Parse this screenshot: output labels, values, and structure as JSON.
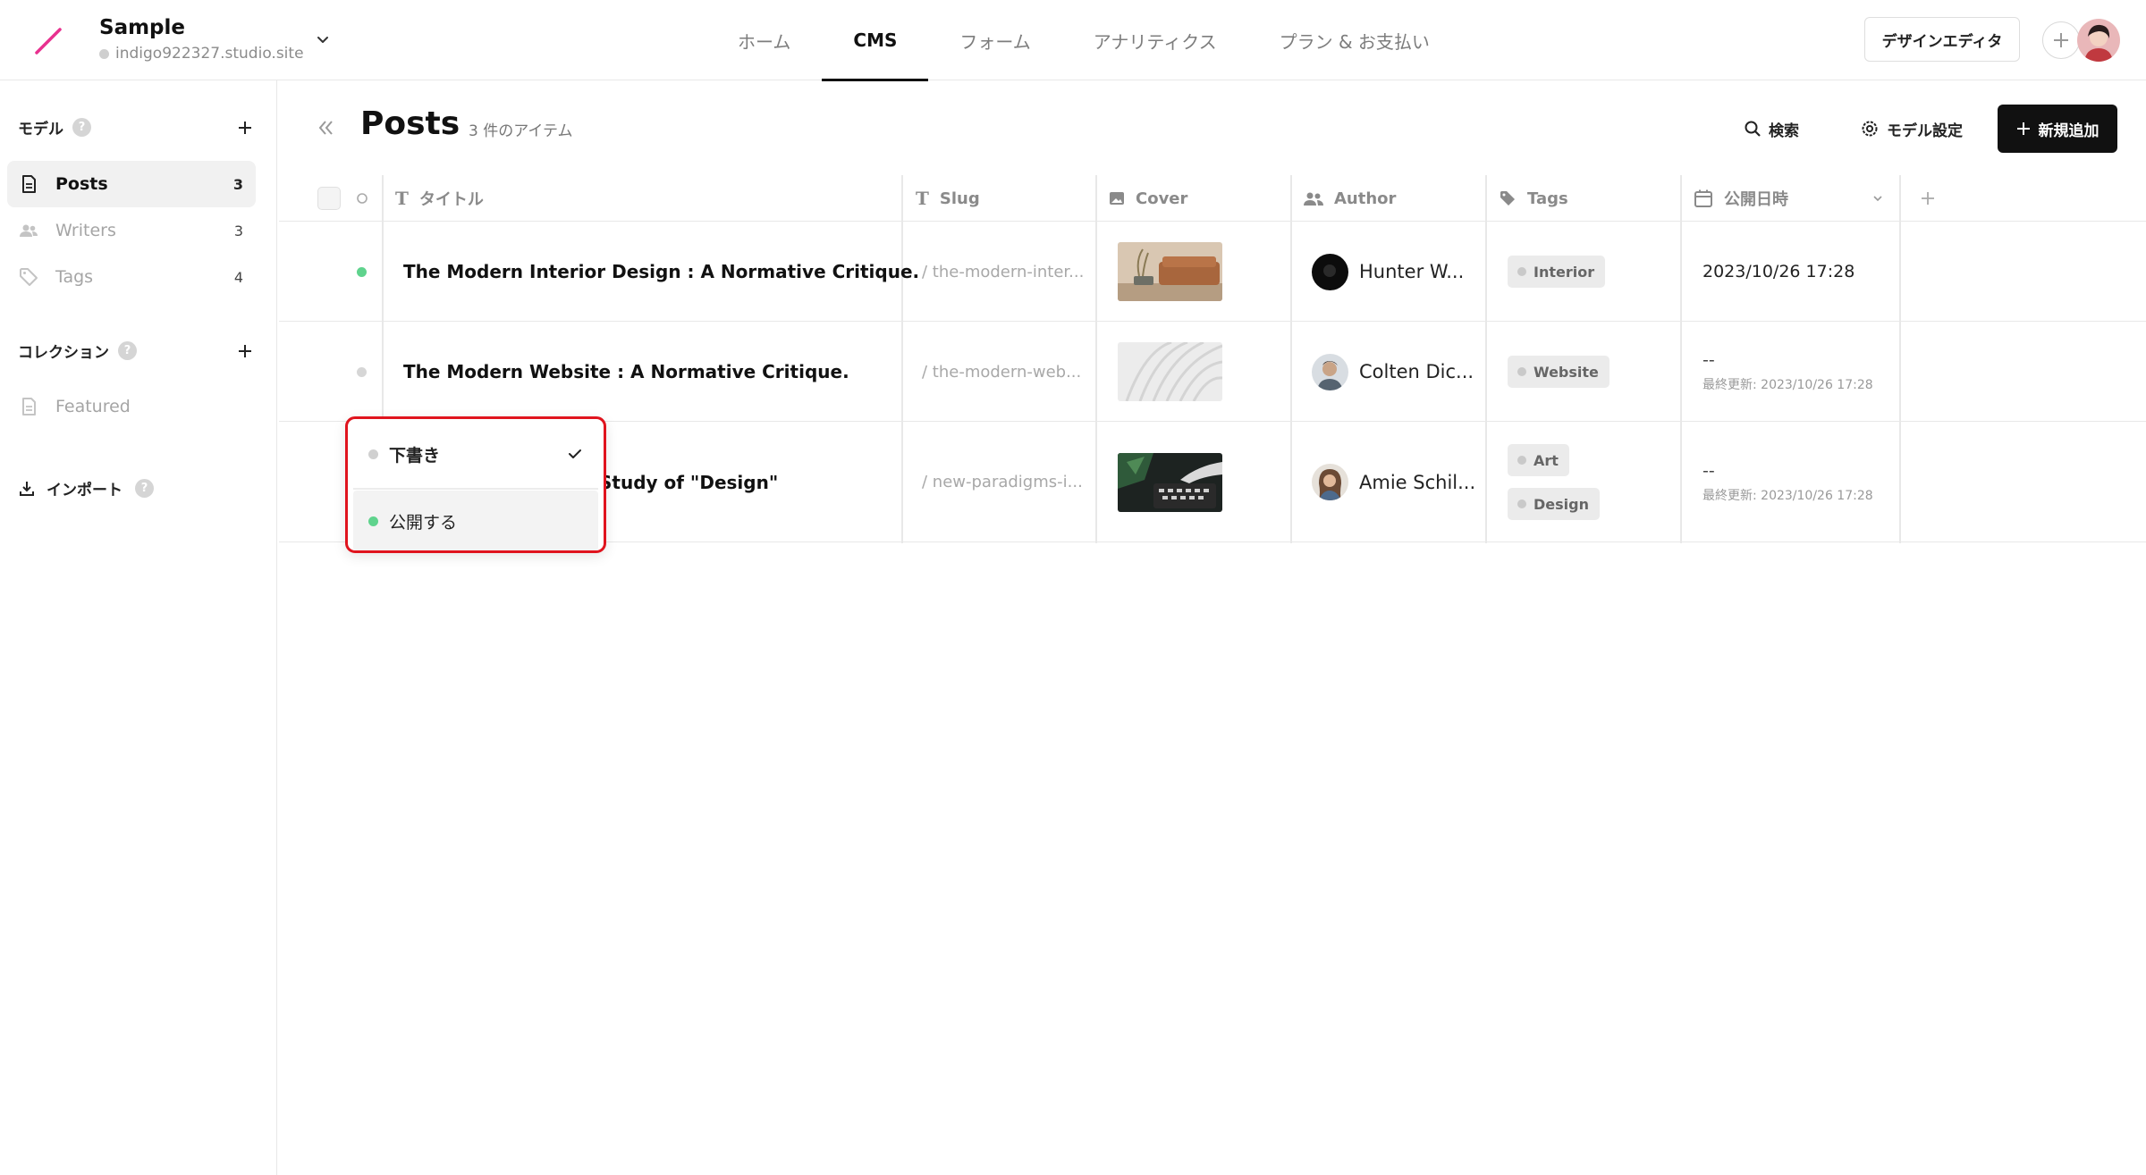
{
  "site": {
    "name": "Sample",
    "url": "indigo922327.studio.site"
  },
  "nav": {
    "items": [
      "ホーム",
      "CMS",
      "フォーム",
      "アナリティクス",
      "プラン & お支払い"
    ],
    "active": "CMS"
  },
  "header_actions": {
    "design_editor": "デザインエディタ"
  },
  "sidebar": {
    "models_title": "モデル",
    "models": [
      {
        "label": "Posts",
        "count": "3",
        "icon": "document-icon"
      },
      {
        "label": "Writers",
        "count": "3",
        "icon": "people-icon"
      },
      {
        "label": "Tags",
        "count": "4",
        "icon": "tag-icon"
      }
    ],
    "collections_title": "コレクション",
    "collections": [
      {
        "label": "Featured",
        "icon": "document-icon"
      }
    ],
    "import_label": "インポート",
    "help_glyph": "?"
  },
  "page": {
    "title": "Posts",
    "count": "3 件のアイテム",
    "search": "検索",
    "model_settings": "モデル設定",
    "new_item": "新規追加"
  },
  "table": {
    "columns": {
      "title": "タイトル",
      "slug": "Slug",
      "cover": "Cover",
      "author": "Author",
      "tags": "Tags",
      "published": "公開日時"
    },
    "rows": [
      {
        "status": "published",
        "title": "The Modern Interior Design : A Normative Critique.",
        "slug": "/ the-modern-inter...",
        "author": "Hunter W...",
        "tags": [
          "Interior"
        ],
        "date": "2023/10/26 17:28",
        "updated": ""
      },
      {
        "status": "draft",
        "title": "The Modern Website : A Normative Critique.",
        "slug": "/ the-modern-web...",
        "author": "Colten Dic...",
        "tags": [
          "Website"
        ],
        "date": "--",
        "updated": "最終更新: 2023/10/26 17:28"
      },
      {
        "status": "draft",
        "title": "Study of \"Design\"",
        "slug": "/ new-paradigms-i...",
        "author": "Amie Schil...",
        "tags": [
          "Art",
          "Design"
        ],
        "date": "--",
        "updated": "最終更新: 2023/10/26 17:28"
      }
    ]
  },
  "dropdown": {
    "options": [
      {
        "label": "下書き",
        "selected": true,
        "dot_color": "#d0d0d0"
      },
      {
        "label": "公開する",
        "selected": false,
        "dot_color": "#5fd38d"
      }
    ]
  },
  "colors": {
    "published_dot": "#5fd38d",
    "draft_dot": "#d6d6d6",
    "logo": "#e8318f",
    "highlight": "#e0141e"
  }
}
